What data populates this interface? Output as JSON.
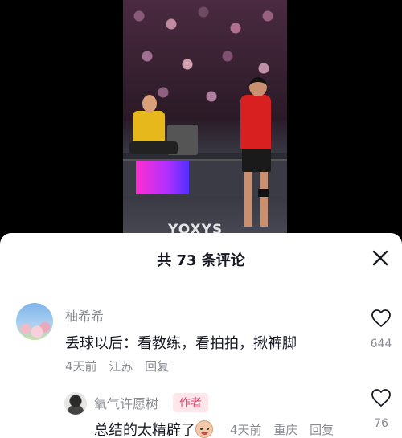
{
  "video": {
    "watermark": "YOXYS"
  },
  "comments_sheet": {
    "title": "共 73 条评论",
    "close_icon": "close-icon"
  },
  "comments": [
    {
      "username": "柚希希",
      "text": "丢球以后：看教练，看拍拍，揪裤脚",
      "time": "4天前",
      "location": "江苏",
      "reply_label": "回复",
      "likes": "644"
    }
  ],
  "reply": {
    "username": "氧气许愿树",
    "badge": "作者",
    "text": "总结的太精辟了",
    "emoji": "smile-emoji",
    "time": "4天前",
    "location": "重庆",
    "reply_label": "回复",
    "likes": "76"
  },
  "colors": {
    "sheet_bg": "#ffffff",
    "text_primary": "#161823",
    "text_secondary": "#8a8b91",
    "author_badge_bg": "#fde7ea",
    "author_badge_text": "#e8436f"
  }
}
